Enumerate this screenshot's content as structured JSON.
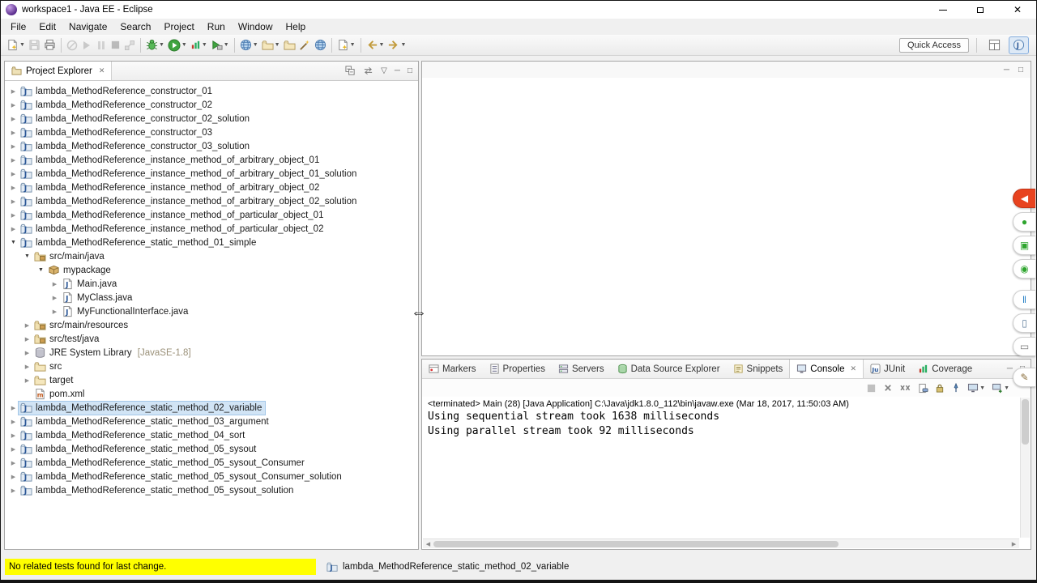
{
  "window": {
    "title": "workspace1 - Java EE - Eclipse"
  },
  "menu": {
    "items": [
      "File",
      "Edit",
      "Navigate",
      "Search",
      "Project",
      "Run",
      "Window",
      "Help"
    ]
  },
  "toolbar": {
    "quick_access": "Quick Access",
    "buttons": [
      {
        "name": "new-wizard",
        "icon": "new-wizard",
        "dropdown": true
      },
      {
        "name": "save",
        "icon": "save",
        "disabled": true
      },
      {
        "name": "print",
        "icon": "print"
      },
      {
        "sep": true
      },
      {
        "name": "skip-all-breakpoints",
        "icon": "skip",
        "disabled": true
      },
      {
        "name": "resume",
        "icon": "resume",
        "disabled": true
      },
      {
        "name": "suspend",
        "icon": "suspend",
        "disabled": true
      },
      {
        "name": "terminate",
        "icon": "terminate",
        "disabled": true
      },
      {
        "name": "disconnect",
        "icon": "disconnect",
        "disabled": true
      },
      {
        "sep": true
      },
      {
        "name": "debug",
        "icon": "debug",
        "dropdown": true
      },
      {
        "name": "run",
        "icon": "run",
        "dropdown": true
      },
      {
        "name": "coverage",
        "icon": "coverage",
        "dropdown": true
      },
      {
        "name": "external-tools",
        "icon": "ext-tools",
        "dropdown": true
      },
      {
        "sep": true
      },
      {
        "name": "web-browser",
        "icon": "globe",
        "dropdown": true
      },
      {
        "name": "open-wizard",
        "icon": "folder",
        "dropdown": true
      },
      {
        "name": "open-resource",
        "icon": "folder"
      },
      {
        "name": "magic-wand",
        "icon": "wand"
      },
      {
        "name": "internal-browser",
        "icon": "globe"
      },
      {
        "sep": true
      },
      {
        "name": "new-java-element",
        "icon": "new-wizard",
        "dropdown": true
      },
      {
        "sep": true
      },
      {
        "name": "back",
        "icon": "back",
        "dropdown": true
      },
      {
        "name": "forward",
        "icon": "forward",
        "dropdown": true
      }
    ]
  },
  "explorer": {
    "tab": "Project Explorer",
    "actions": [
      {
        "name": "collapse-all",
        "icon": "collapse-all"
      },
      {
        "name": "link-with-editor",
        "icon": "link-editor"
      },
      {
        "name": "view-menu",
        "icon": "view-menu"
      },
      {
        "name": "minimize",
        "icon": "minimize"
      },
      {
        "name": "maximize",
        "icon": "maximize"
      }
    ],
    "tree": [
      {
        "level": 0,
        "arrow": "c",
        "icon": "project",
        "label": "lambda_MethodReference_constructor_01"
      },
      {
        "level": 0,
        "arrow": "c",
        "icon": "project",
        "label": "lambda_MethodReference_constructor_02"
      },
      {
        "level": 0,
        "arrow": "c",
        "icon": "project",
        "label": "lambda_MethodReference_constructor_02_solution"
      },
      {
        "level": 0,
        "arrow": "c",
        "icon": "project",
        "label": "lambda_MethodReference_constructor_03"
      },
      {
        "level": 0,
        "arrow": "c",
        "icon": "project",
        "label": "lambda_MethodReference_constructor_03_solution"
      },
      {
        "level": 0,
        "arrow": "c",
        "icon": "project",
        "label": "lambda_MethodReference_instance_method_of_arbitrary_object_01"
      },
      {
        "level": 0,
        "arrow": "c",
        "icon": "project",
        "label": "lambda_MethodReference_instance_method_of_arbitrary_object_01_solution"
      },
      {
        "level": 0,
        "arrow": "c",
        "icon": "project",
        "label": "lambda_MethodReference_instance_method_of_arbitrary_object_02"
      },
      {
        "level": 0,
        "arrow": "c",
        "icon": "project",
        "label": "lambda_MethodReference_instance_method_of_arbitrary_object_02_solution"
      },
      {
        "level": 0,
        "arrow": "c",
        "icon": "project",
        "label": "lambda_MethodReference_instance_method_of_particular_object_01"
      },
      {
        "level": 0,
        "arrow": "c",
        "icon": "project",
        "label": "lambda_MethodReference_instance_method_of_particular_object_02"
      },
      {
        "level": 0,
        "arrow": "e",
        "icon": "project",
        "label": "lambda_MethodReference_static_method_01_simple"
      },
      {
        "level": 1,
        "arrow": "e",
        "icon": "src",
        "label": "src/main/java"
      },
      {
        "level": 2,
        "arrow": "e",
        "icon": "package",
        "label": "mypackage"
      },
      {
        "level": 3,
        "arrow": "c",
        "icon": "java",
        "label": "Main.java"
      },
      {
        "level": 3,
        "arrow": "c",
        "icon": "java",
        "label": "MyClass.java"
      },
      {
        "level": 3,
        "arrow": "c",
        "icon": "java",
        "label": "MyFunctionalInterface.java"
      },
      {
        "level": 1,
        "arrow": "c",
        "icon": "src",
        "label": "src/main/resources"
      },
      {
        "level": 1,
        "arrow": "c",
        "icon": "src",
        "label": "src/test/java"
      },
      {
        "level": 1,
        "arrow": "c",
        "icon": "lib",
        "label": "JRE System Library",
        "decoration": "[JavaSE-1.8]"
      },
      {
        "level": 1,
        "arrow": "c",
        "icon": "folder",
        "label": "src"
      },
      {
        "level": 1,
        "arrow": "c",
        "icon": "folder",
        "label": "target"
      },
      {
        "level": 1,
        "arrow": null,
        "icon": "xml",
        "label": "pom.xml"
      },
      {
        "level": 0,
        "arrow": "c",
        "icon": "project",
        "label": "lambda_MethodReference_static_method_02_variable",
        "selected": true
      },
      {
        "level": 0,
        "arrow": "c",
        "icon": "project",
        "label": "lambda_MethodReference_static_method_03_argument"
      },
      {
        "level": 0,
        "arrow": "c",
        "icon": "project",
        "label": "lambda_MethodReference_static_method_04_sort"
      },
      {
        "level": 0,
        "arrow": "c",
        "icon": "project",
        "label": "lambda_MethodReference_static_method_05_sysout"
      },
      {
        "level": 0,
        "arrow": "c",
        "icon": "project",
        "label": "lambda_MethodReference_static_method_05_sysout_Consumer"
      },
      {
        "level": 0,
        "arrow": "c",
        "icon": "project",
        "label": "lambda_MethodReference_static_method_05_sysout_Consumer_solution"
      },
      {
        "level": 0,
        "arrow": "c",
        "icon": "project",
        "label": "lambda_MethodReference_static_method_05_sysout_solution"
      }
    ]
  },
  "bottom_panel": {
    "tabs": [
      {
        "label": "Markers",
        "icon": "markers"
      },
      {
        "label": "Properties",
        "icon": "properties"
      },
      {
        "label": "Servers",
        "icon": "servers"
      },
      {
        "label": "Data Source Explorer",
        "icon": "datasource"
      },
      {
        "label": "Snippets",
        "icon": "snippets"
      },
      {
        "label": "Console",
        "icon": "console",
        "active": true,
        "closable": true
      },
      {
        "label": "JUnit",
        "icon": "junit"
      },
      {
        "label": "Coverage",
        "icon": "coverage"
      }
    ],
    "actions": [
      {
        "name": "terminate",
        "icon": "terminate",
        "disabled": true
      },
      {
        "name": "remove-launch",
        "icon": "remove"
      },
      {
        "name": "remove-all-terminated",
        "icon": "remove-all"
      },
      {
        "name": "clear-console",
        "icon": "clear"
      },
      {
        "name": "scroll-lock",
        "icon": "scroll-lock"
      },
      {
        "name": "pin-console",
        "icon": "pin"
      },
      {
        "name": "display-selected-console",
        "icon": "display",
        "dropdown": true
      },
      {
        "name": "open-console",
        "icon": "open-console",
        "dropdown": true
      }
    ],
    "console": {
      "title": "<terminated> Main (28) [Java Application] C:\\Java\\jdk1.8.0_112\\bin\\javaw.exe (Mar 18, 2017, 11:50:03 AM)",
      "lines": [
        "Using sequential stream took 1638 milliseconds",
        "Using parallel stream took 92 milliseconds"
      ]
    }
  },
  "status_bar": {
    "message": "No related tests found for last change.",
    "selection": "lambda_MethodReference_static_method_02_variable"
  },
  "overlay": {
    "buttons": [
      {
        "name": "collapse",
        "style": "primary"
      },
      {
        "name": "plugin"
      },
      {
        "name": "camera"
      },
      {
        "name": "record"
      },
      {
        "name": "pause",
        "gap": true
      },
      {
        "name": "mobile"
      },
      {
        "name": "display"
      },
      {
        "name": "edit",
        "gap": true
      }
    ]
  }
}
